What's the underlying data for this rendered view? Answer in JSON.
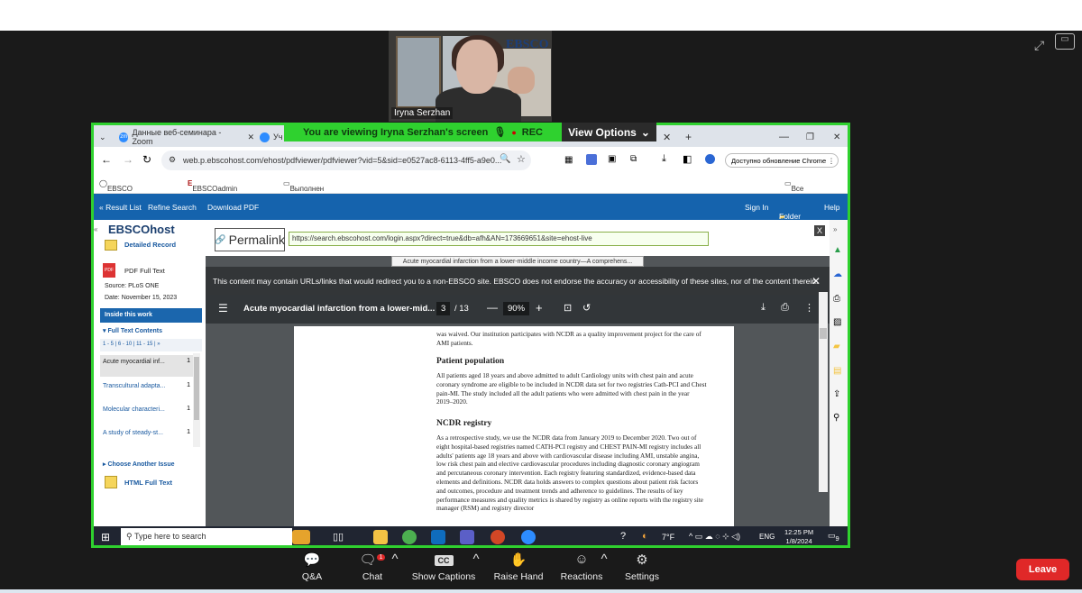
{
  "participant": {
    "name": "Iryna Serzhan",
    "bg_logo": "EBSCO"
  },
  "share_banner": {
    "text": "You are viewing  Iryna Serzhan's screen",
    "rec": "REC",
    "view_options": "View Options"
  },
  "browser": {
    "tabs": [
      {
        "label": "Данные веб-семинара - Zoom"
      },
      {
        "label": "Уч"
      }
    ],
    "new_tab": "+",
    "url": "web.p.ebscohost.com/ehost/pdfviewer/pdfviewer?vid=5&sid=e0527ac8-6113-4ff5-a9e0...",
    "update_button": "Доступно обновление Chrome",
    "bookmarks": [
      "EBSCO Industries -...",
      "EBSCOadmin > Cust...",
      "Выполнен импорт"
    ],
    "all_bookmarks": "Все закладки"
  },
  "ebsco_nav": {
    "left": [
      "« Result List",
      "Refine Search",
      "Download PDF"
    ],
    "right": [
      "Sign In",
      "Folder",
      "Help"
    ]
  },
  "left_pane": {
    "logo": "EBSCOhost",
    "detailed_record": "Detailed Record",
    "pdf_full_text": "PDF Full Text",
    "source_label": "Source:",
    "source_value": "PLoS ONE",
    "date_label": "Date:",
    "date_value": "November 15, 2023",
    "inside_this_work": "Inside this work",
    "full_text_contents": "Full Text Contents",
    "pages_nav": "1 - 5 | 6 - 10 | 11 - 15 | »",
    "items": [
      {
        "title": "Acute myocardial inf...",
        "page": "1"
      },
      {
        "title": "Transcultural adapta...",
        "page": "1"
      },
      {
        "title": "Molecular characteri...",
        "page": "1"
      },
      {
        "title": "A study of steady-st...",
        "page": "1"
      }
    ],
    "choose_issue": "Choose Another Issue",
    "html_full_text": "HTML Full Text"
  },
  "viewer": {
    "permalink_label": "Permalink",
    "permalink_url": "https://search.ebscohost.com/login.aspx?direct=true&db=afh&AN=173669651&site=ehost-live",
    "tab_title": "Acute myocardial infarction from a lower-middle income country—A comprehens...",
    "warning": "This content may contain URLs/links that would redirect you to a non-EBSCO site. EBSCO does not endorse the accuracy or accessibility of these sites, nor of the content therein.",
    "pdf_title": "Acute myocardial infarction from a lower-mid...",
    "page_current": "3",
    "page_total": "/ 13",
    "zoom": "90%"
  },
  "document": {
    "p1": "was waived. Our institution participates with NCDR as a quality improvement project for the care of AMI patients.",
    "h1": "Patient population",
    "p2": "All patients aged 18 years and above admitted to adult Cardiology units with chest pain and acute coronary syndrome are eligible to be included in NCDR data set for two registries Cath-PCI and Chest pain-MI. The study included all the adult patients who were admitted with chest pain in the year 2019–2020.",
    "h2": "NCDR registry",
    "p3": "As a retrospective study, we use the NCDR data from January 2019 to December 2020. Two out of eight hospital-based registries named CATH-PCI registry and CHEST PAIN-MI registry includes all adults' patients age 18 years and above with cardiovascular disease including AMI, unstable angina, low risk chest pain and elective cardiovascular procedures including diagnostic coronary angiogram and percutaneous coronary intervention. Each registry featuring standardized, evidence-based data elements and definitions. NCDR data holds answers to complex questions about patient risk factors and outcomes, procedure and treatment trends and adherence to guidelines. The results of key performance measures and quality metrics is shared by registry as online reports with the registry site manager (RSM) and registry director"
  },
  "taskbar": {
    "search_placeholder": "Type here to search",
    "weather": "7°F",
    "lang": "ENG",
    "time": "12:25 PM",
    "date": "1/8/2024",
    "notif": "9"
  },
  "zoom_bar": {
    "items": [
      "Q&A",
      "Chat",
      "Show Captions",
      "Raise Hand",
      "Reactions",
      "Settings"
    ],
    "chat_badge": "1",
    "leave": "Leave"
  }
}
